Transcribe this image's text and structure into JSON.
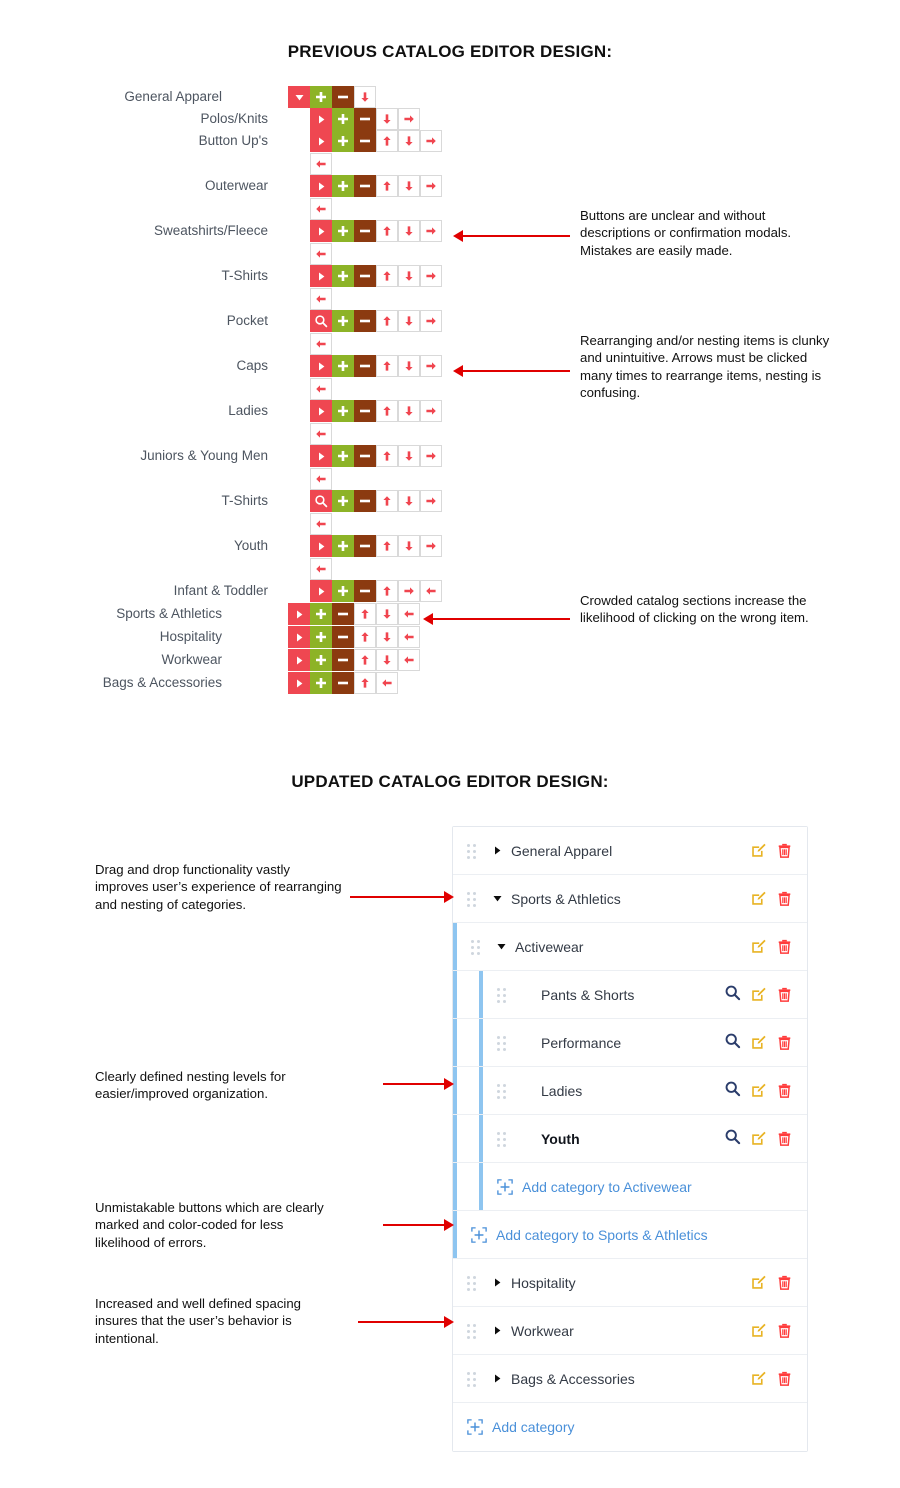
{
  "sections": {
    "previous_title": "PREVIOUS CATALOG EDITOR DESIGN:",
    "updated_title": "UPDATED CATALOG EDITOR DESIGN:"
  },
  "old_design": {
    "rows": [
      {
        "label": "General Apparel",
        "indent": 0,
        "first": "caret-down",
        "buttons": [
          "add",
          "remove",
          "down"
        ]
      },
      {
        "label": "Polos/Knits",
        "indent": 1,
        "first": "caret-right",
        "buttons": [
          "add",
          "remove",
          "down",
          "left"
        ]
      },
      {
        "label": "Button Up's",
        "indent": 1,
        "first": "caret-right",
        "buttons": [
          "add",
          "remove",
          "up",
          "down",
          "left"
        ]
      },
      {
        "label": "",
        "indent": 1,
        "first": "",
        "buttons": [
          "right"
        ]
      },
      {
        "label": "Outerwear",
        "indent": 1,
        "first": "caret-right",
        "buttons": [
          "add",
          "remove",
          "up",
          "down",
          "left"
        ]
      },
      {
        "label": "",
        "indent": 1,
        "first": "",
        "buttons": [
          "right"
        ]
      },
      {
        "label": "Sweatshirts/Fleece",
        "indent": 1,
        "first": "caret-right",
        "buttons": [
          "add",
          "remove",
          "up",
          "down",
          "left"
        ]
      },
      {
        "label": "",
        "indent": 1,
        "first": "",
        "buttons": [
          "right"
        ]
      },
      {
        "label": "T-Shirts",
        "indent": 1,
        "first": "caret-right",
        "buttons": [
          "add",
          "remove",
          "up",
          "down",
          "left"
        ]
      },
      {
        "label": "",
        "indent": 1,
        "first": "",
        "buttons": [
          "right"
        ]
      },
      {
        "label": "Pocket",
        "indent": 1,
        "first": "search",
        "buttons": [
          "add",
          "remove",
          "up",
          "down",
          "left"
        ]
      },
      {
        "label": "",
        "indent": 1,
        "first": "",
        "buttons": [
          "right"
        ]
      },
      {
        "label": "Caps",
        "indent": 1,
        "first": "caret-right",
        "buttons": [
          "add",
          "remove",
          "up",
          "down",
          "left"
        ]
      },
      {
        "label": "",
        "indent": 1,
        "first": "",
        "buttons": [
          "right"
        ]
      },
      {
        "label": "Ladies",
        "indent": 1,
        "first": "caret-right",
        "buttons": [
          "add",
          "remove",
          "up",
          "down",
          "left"
        ]
      },
      {
        "label": "",
        "indent": 1,
        "first": "",
        "buttons": [
          "right"
        ]
      },
      {
        "label": "Juniors & Young Men",
        "indent": 1,
        "first": "caret-right",
        "buttons": [
          "add",
          "remove",
          "up",
          "down",
          "left"
        ]
      },
      {
        "label": "",
        "indent": 1,
        "first": "",
        "buttons": [
          "right"
        ]
      },
      {
        "label": "T-Shirts",
        "indent": 1,
        "first": "search",
        "buttons": [
          "add",
          "remove",
          "up",
          "down",
          "left"
        ]
      },
      {
        "label": "",
        "indent": 1,
        "first": "",
        "buttons": [
          "right"
        ]
      },
      {
        "label": "Youth",
        "indent": 1,
        "first": "caret-right",
        "buttons": [
          "add",
          "remove",
          "up",
          "down",
          "left"
        ]
      },
      {
        "label": "",
        "indent": 1,
        "first": "",
        "buttons": [
          "right"
        ]
      },
      {
        "label": "Infant & Toddler",
        "indent": 1,
        "first": "caret-right",
        "buttons": [
          "add",
          "remove",
          "up",
          "left",
          "right"
        ]
      },
      {
        "label": "Sports & Athletics",
        "indent": 0,
        "first": "caret-right",
        "buttons": [
          "add",
          "remove",
          "up",
          "down",
          "right"
        ]
      },
      {
        "label": "Hospitality",
        "indent": 0,
        "first": "caret-right",
        "buttons": [
          "add",
          "remove",
          "up",
          "down",
          "right"
        ]
      },
      {
        "label": "Workwear",
        "indent": 0,
        "first": "caret-right",
        "buttons": [
          "add",
          "remove",
          "up",
          "down",
          "right"
        ]
      },
      {
        "label": "Bags & Accessories",
        "indent": 0,
        "first": "caret-right",
        "buttons": [
          "add",
          "remove",
          "up",
          "right"
        ]
      }
    ],
    "colors": {
      "expand": "#ef4751",
      "add": "#8db327",
      "remove": "#8b3a10",
      "move_arrow": "#f0454f"
    }
  },
  "annotations": {
    "old": [
      {
        "text": "Buttons are unclear and without descriptions or confirmation modals. Mistakes are easily made."
      },
      {
        "text": "Rearranging and/or nesting items is clunky and unintuitive. Arrows must be clicked many times to rearrange items, nesting is confusing."
      },
      {
        "text": "Crowded catalog sections increase the likelihood of clicking on the wrong item."
      }
    ],
    "new": [
      {
        "text": "Drag and drop functionality vastly improves user’s experience of rearranging and nesting of categories."
      },
      {
        "text": "Clearly defined nesting levels for easier/improved organization."
      },
      {
        "text": "Unmistakable buttons which are clearly marked and color-coded for less likelihood of errors."
      },
      {
        "text": "Increased and well defined spacing insures that the user’s behavior is intentional."
      }
    ]
  },
  "new_design": {
    "rows": [
      {
        "type": "category",
        "label": "General Apparel",
        "level": 0,
        "caret": "right",
        "actions": [
          "edit",
          "delete"
        ],
        "bold": false
      },
      {
        "type": "category",
        "label": "Sports & Athletics",
        "level": 0,
        "caret": "down",
        "actions": [
          "edit",
          "delete"
        ],
        "bold": false
      },
      {
        "type": "category",
        "label": "Activewear",
        "level": 1,
        "caret": "down",
        "actions": [
          "edit",
          "delete"
        ],
        "bold": false
      },
      {
        "type": "category",
        "label": "Pants & Shorts",
        "level": 2,
        "caret": "none",
        "actions": [
          "search",
          "edit",
          "delete"
        ],
        "bold": false
      },
      {
        "type": "category",
        "label": "Performance",
        "level": 2,
        "caret": "none",
        "actions": [
          "search",
          "edit",
          "delete"
        ],
        "bold": false
      },
      {
        "type": "category",
        "label": "Ladies",
        "level": 2,
        "caret": "none",
        "actions": [
          "search",
          "edit",
          "delete"
        ],
        "bold": false
      },
      {
        "type": "category",
        "label": "Youth",
        "level": 2,
        "caret": "none",
        "actions": [
          "search",
          "edit",
          "delete"
        ],
        "bold": true
      },
      {
        "type": "add",
        "label": "Add category to Activewear",
        "level": 2
      },
      {
        "type": "add",
        "label": "Add category to Sports & Athletics",
        "level": 1
      },
      {
        "type": "category",
        "label": "Hospitality",
        "level": 0,
        "caret": "right",
        "actions": [
          "edit",
          "delete"
        ],
        "bold": false
      },
      {
        "type": "category",
        "label": "Workwear",
        "level": 0,
        "caret": "right",
        "actions": [
          "edit",
          "delete"
        ],
        "bold": false
      },
      {
        "type": "category",
        "label": "Bags & Accessories",
        "level": 0,
        "caret": "right",
        "actions": [
          "edit",
          "delete"
        ],
        "bold": false
      },
      {
        "type": "add",
        "label": "Add category",
        "level": 0
      }
    ],
    "colors": {
      "edit_icon": "#e8b323",
      "delete_icon": "#ff3c3c",
      "search_icon": "#2b3d6b",
      "add_link": "#4a90d9",
      "indent_bar": "#8ec5f0",
      "grip": "#cfd6de"
    }
  }
}
